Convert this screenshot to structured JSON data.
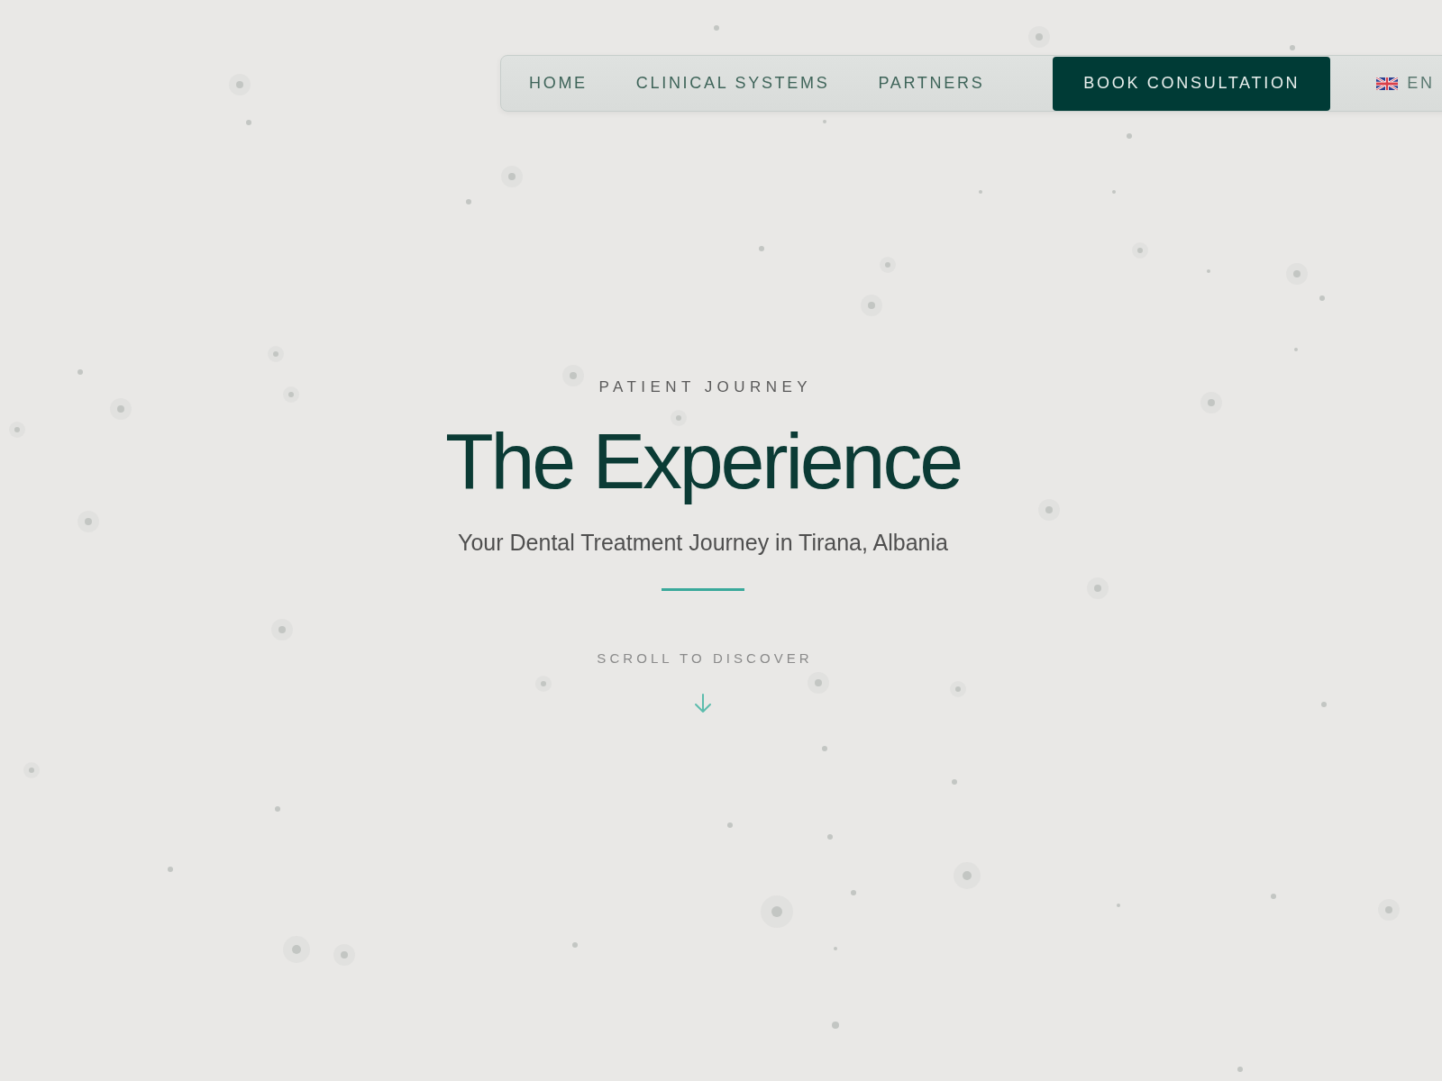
{
  "nav": {
    "links": [
      {
        "label": "HOME"
      },
      {
        "label": "CLINICAL SYSTEMS"
      },
      {
        "label": "PARTNERS"
      }
    ],
    "cta": "BOOK CONSULTATION",
    "language": {
      "code": "EN"
    }
  },
  "hero": {
    "eyebrow": "PATIENT JOURNEY",
    "title": "The Experience",
    "subtitle": "Your Dental Treatment Journey in Tirana, Albania",
    "scroll_hint": "SCROLL TO DISCOVER"
  }
}
